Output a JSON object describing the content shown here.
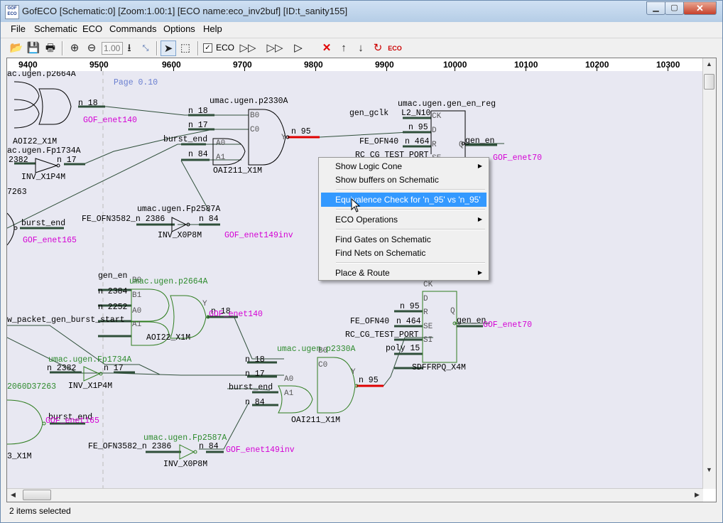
{
  "window": {
    "title": "GofECO [Schematic:0] [Zoom:1.00:1] [ECO name:eco_inv2buf] [ID:t_sanity155]",
    "icon_label": "GOF ECO"
  },
  "menubar": [
    "File",
    "Schematic",
    "ECO",
    "Commands",
    "Options",
    "Help"
  ],
  "toolbar": {
    "zoom_value": "1.00",
    "eco_label": "ECO",
    "eco_checked": "✓"
  },
  "ruler": [
    "9400",
    "9500",
    "9600",
    "9700",
    "9800",
    "9900",
    "10000",
    "10100",
    "10200",
    "10300"
  ],
  "schematic": {
    "page_label": "Page 0.10",
    "upper": {
      "cell_top_left": "ac.ugen.p2664A",
      "aoi_label": "AOI22_X1M",
      "inv_inst": "ac.ugen.Fp1734A",
      "n2382": "2382",
      "n17a": "n 17",
      "inv_x1p4m": "INV_X1P4M",
      "num7263": "7263",
      "n18a": "n 18",
      "gof_enet140": "GOF_enet140",
      "burst_end_left": "burst_end",
      "gof_enet165": "GOF_enet165",
      "oai_inst": "umac.ugen.p2330A",
      "n18b": "n 18",
      "n17b": "n 17",
      "burst_end": "burst_end",
      "n84a": "n 84",
      "oai_label": "OAI211_X1M",
      "b0": "B0",
      "c0": "C0",
      "a0": "A0",
      "a1": "A1",
      "y": "Y",
      "n95": "n 95",
      "inv2_inst": "umac.ugen.Fp2587A",
      "fe3582": "FE_OFN3582_n 2386",
      "n84b": "n 84",
      "inv_x0p8m": "INV_X0P8M",
      "gof_enet149inv": "GOF_enet149inv",
      "reg_inst": "umac.ugen.gen_en_reg",
      "gen_gclk": "gen_gclk",
      "l2n10": "L2_N10",
      "n95b": "n 95",
      "fe40": "FE_OFN40",
      "n464": "n 464",
      "rc_cg": "RC_CG_TEST_PORT",
      "ck": "CK",
      "d": "D",
      "r": "R",
      "se": "SE",
      "q": "Q",
      "gen_en": "gen_en",
      "gof_enet70": "GOF_enet70"
    },
    "lower": {
      "cell": "umac.ugen.p2664A",
      "gen_en": "gen_en",
      "n2384": "n 2384",
      "n2252": "n 2252",
      "wpacket": "w_packet_gen_burst_start",
      "b0": "B0",
      "b1": "B1",
      "a0": "A0",
      "a1": "A1",
      "y": "Y",
      "aoi_label": "AOI22_X1M",
      "n18": "n 18",
      "gof_enet140": "GOF_enet140",
      "inv_inst": "umac.ugen.Fp1734A",
      "n2382": "n 2382",
      "n17": "n 17",
      "inv_x1p4m": "INV_X1P4M",
      "d37263": "2060D37263",
      "burst_end": "burst_end",
      "gof_enet165": "GOF_enet165",
      "x1m": "3_X1M",
      "oai_inst": "umac.ugen.p2330A",
      "n18b": "n 18",
      "n17b": "n 17",
      "burst_end2": "burst_end",
      "n84": "n 84",
      "oai_label": "OAI211_X1M",
      "c0": "C0",
      "y2": "Y",
      "n95": "n 95",
      "inv2_inst": "umac.ugen.Fp2587A",
      "fe3582": "FE_OFN3582_n 2386",
      "n84b": "n 84",
      "inv_x0p8m": "INV_X0P8M",
      "gof_enet149inv": "GOF_enet149inv",
      "n95b": "n 95",
      "fe40": "FE_OFN40",
      "n464": "n 464",
      "rc_cg": "RC_CG_TEST_PORT",
      "poly15": "poly 15",
      "ck": "CK",
      "d": "D",
      "r": "R",
      "se": "SE",
      "si": "SI",
      "q": "Q",
      "gen_en_out": "gen_en",
      "gof_enet70": "GOF_enet70",
      "sdff": "SDFFRPQ_X4M"
    }
  },
  "context_menu": [
    {
      "label": "Show Logic Cone",
      "submenu": "▶"
    },
    {
      "label": "Show buffers on Schematic",
      "submenu": ""
    },
    {
      "label": "Equivalence Check for 'n_95' vs 'n_95'",
      "submenu": ""
    },
    {
      "label": "ECO Operations",
      "submenu": "▶"
    },
    {
      "label": "Find Gates on Schematic",
      "submenu": ""
    },
    {
      "label": "Find Nets on Schematic",
      "submenu": ""
    },
    {
      "label": "Place & Route",
      "submenu": "▶"
    }
  ],
  "status": {
    "text": "2 items selected"
  },
  "colors": {
    "net": "#3a6b4a",
    "gate_black": "#000000",
    "gate_green": "#2e7d1f",
    "gof": "#d400d4",
    "inst_green": "#2e8b2e",
    "selected": "#e00000",
    "page": "#6a7fd0"
  }
}
